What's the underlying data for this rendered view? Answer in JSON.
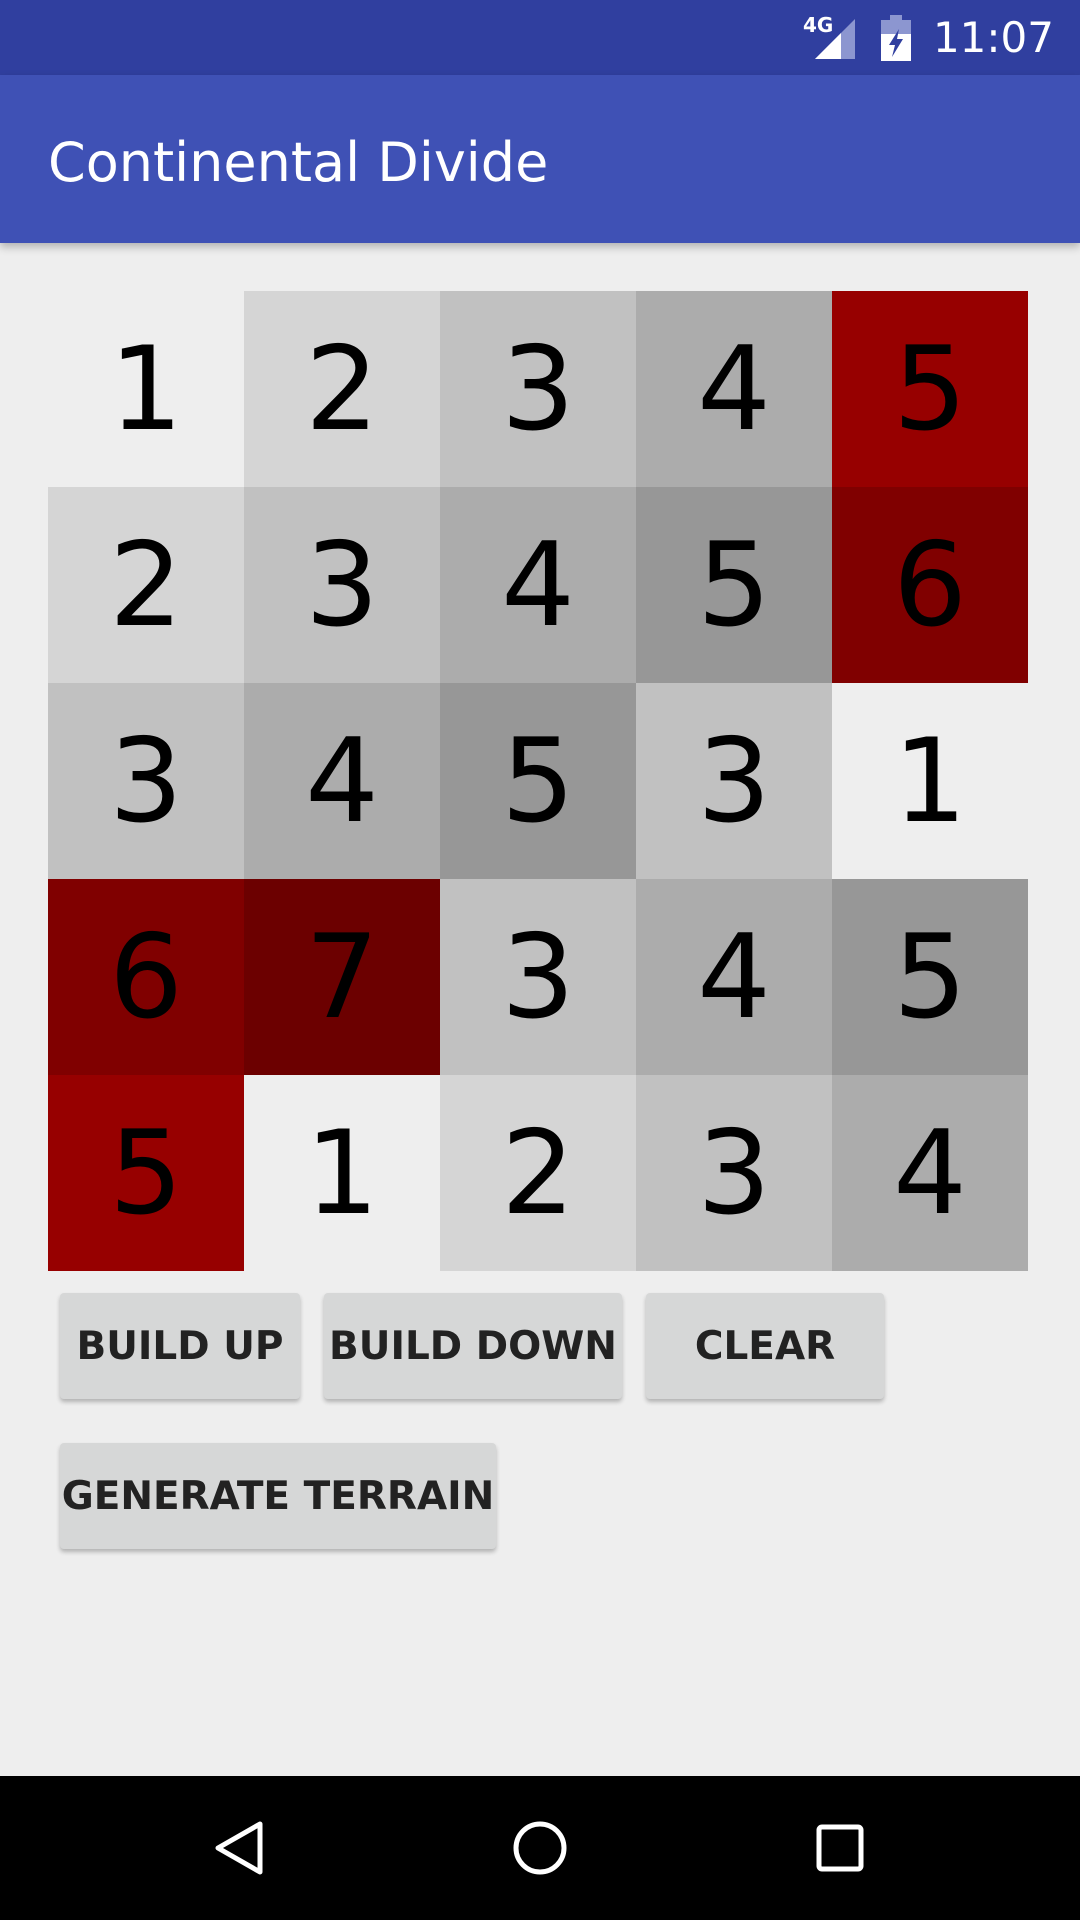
{
  "status_bar": {
    "network": "4G",
    "time": "11:07",
    "icons": [
      "signal-icon",
      "battery-charging-icon"
    ]
  },
  "app_bar": {
    "title": "Continental Divide"
  },
  "grid": {
    "rows": [
      [
        {
          "v": "1",
          "c": "#eeeeee"
        },
        {
          "v": "2",
          "c": "#d5d5d5"
        },
        {
          "v": "3",
          "c": "#c1c1c1"
        },
        {
          "v": "4",
          "c": "#acacac"
        },
        {
          "v": "5",
          "c": "#970000"
        }
      ],
      [
        {
          "v": "2",
          "c": "#d5d5d5"
        },
        {
          "v": "3",
          "c": "#c1c1c1"
        },
        {
          "v": "4",
          "c": "#acacac"
        },
        {
          "v": "5",
          "c": "#979797"
        },
        {
          "v": "6",
          "c": "#800000"
        }
      ],
      [
        {
          "v": "3",
          "c": "#c1c1c1"
        },
        {
          "v": "4",
          "c": "#acacac"
        },
        {
          "v": "5",
          "c": "#979797"
        },
        {
          "v": "3",
          "c": "#c1c1c1"
        },
        {
          "v": "1",
          "c": "#eeeeee"
        }
      ],
      [
        {
          "v": "6",
          "c": "#800000"
        },
        {
          "v": "7",
          "c": "#6c0000"
        },
        {
          "v": "3",
          "c": "#c1c1c1"
        },
        {
          "v": "4",
          "c": "#acacac"
        },
        {
          "v": "5",
          "c": "#979797"
        }
      ],
      [
        {
          "v": "5",
          "c": "#970000"
        },
        {
          "v": "1",
          "c": "#eeeeee"
        },
        {
          "v": "2",
          "c": "#d5d5d5"
        },
        {
          "v": "3",
          "c": "#c1c1c1"
        },
        {
          "v": "4",
          "c": "#acacac"
        }
      ]
    ]
  },
  "buttons": {
    "build_up": "BUILD UP",
    "build_down": "BUILD DOWN",
    "clear": "CLEAR",
    "generate_terrain": "GENERATE TERRAIN"
  },
  "nav_bar": {
    "icons": [
      "back-icon",
      "home-icon",
      "recents-icon"
    ]
  },
  "colors": {
    "status_bar": "#303f9f",
    "app_bar": "#3f51b5",
    "background": "#eeeeee",
    "button": "#d6d7d7"
  }
}
